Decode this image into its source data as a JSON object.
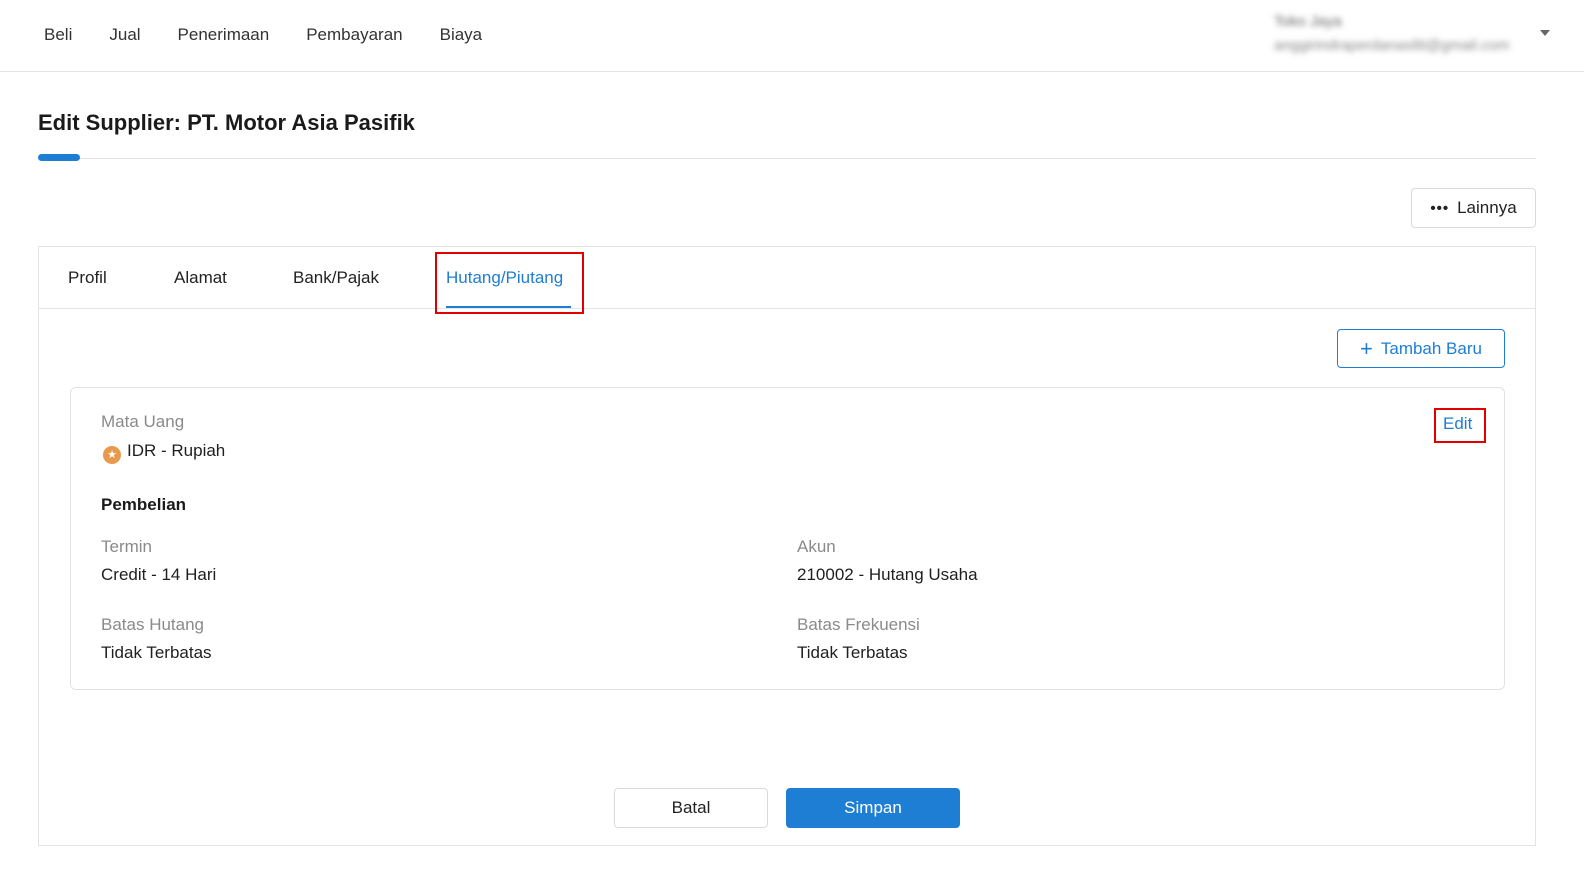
{
  "nav": {
    "items": [
      "Beli",
      "Jual",
      "Penerimaan",
      "Pembayaran",
      "Biaya"
    ]
  },
  "user": {
    "name": "Toko Jaya",
    "email": "anggirindraperdanasilit@gmail.com"
  },
  "page": {
    "title": "Edit Supplier: PT. Motor Asia Pasifik",
    "more_label": "Lainnya"
  },
  "tabs": [
    {
      "label": "Profil"
    },
    {
      "label": "Alamat"
    },
    {
      "label": "Bank/Pajak"
    },
    {
      "label": "Hutang/Piutang"
    }
  ],
  "add_button": "Tambah Baru",
  "card": {
    "currency_label": "Mata Uang",
    "currency_value": "IDR - Rupiah",
    "edit_label": "Edit",
    "section_title": "Pembelian",
    "termin_label": "Termin",
    "termin_value": "Credit - 14 Hari",
    "akun_label": "Akun",
    "akun_value": "210002 - Hutang Usaha",
    "batas_hutang_label": "Batas Hutang",
    "batas_hutang_value": "Tidak Terbatas",
    "batas_frekuensi_label": "Batas Frekuensi",
    "batas_frekuensi_value": "Tidak Terbatas"
  },
  "footer": {
    "cancel_label": "Batal",
    "save_label": "Simpan"
  },
  "colors": {
    "accent": "#1e7ed4",
    "highlight": "#e00000"
  },
  "active_tab": "Hutang/Piutang"
}
